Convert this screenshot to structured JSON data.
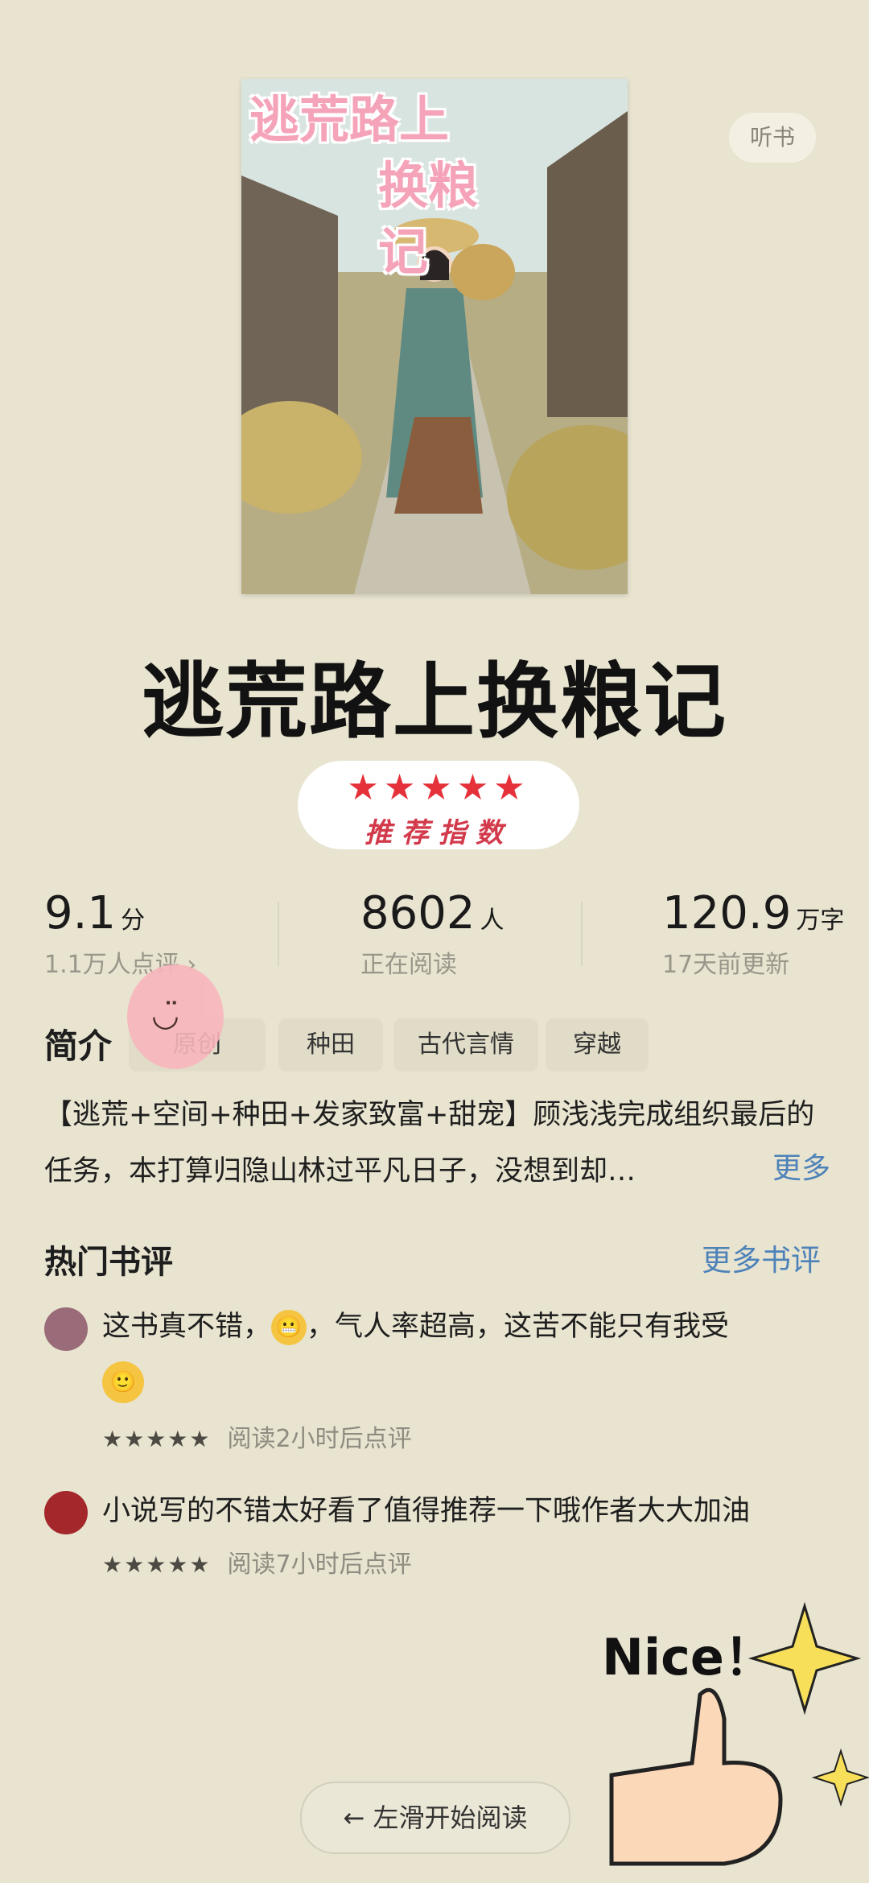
{
  "header": {
    "listen_label": "听书"
  },
  "cover": {
    "title_line1": "逃荒路上",
    "title_line2": "换粮记"
  },
  "book": {
    "title": "逃荒路上换粮记"
  },
  "recommend": {
    "stars": "★★★★★",
    "label": "推荐指数"
  },
  "stats": [
    {
      "value": "9.1",
      "unit": "分",
      "sub": "1.1万人点评 ›"
    },
    {
      "value": "8602",
      "unit": "人",
      "sub": "正在阅读"
    },
    {
      "value": "120.9",
      "unit": "万字",
      "sub": "17天前更新"
    }
  ],
  "intro": {
    "label": "简介",
    "tags": [
      "原创",
      "种田",
      "古代言情",
      "穿越"
    ],
    "text": "【逃荒+空间+种田+发家致富+甜宠】顾浅浅完成组织最后的任务，本打算归隐山林过平凡日子，没想到却…",
    "more": "更多"
  },
  "reviews_section": {
    "title": "热门书评",
    "more": "更多书评"
  },
  "reviews": [
    {
      "text_a": "这书真不错，",
      "text_b": "，气人率超高，这苦不能只有我受",
      "stars": "★★★★★",
      "meta": "阅读2小时后点评"
    },
    {
      "text": "小说写的不错太好看了值得推荐一下哦作者大大加油",
      "stars": "★★★★★",
      "meta": "阅读7小时后点评"
    }
  ],
  "sticker": {
    "text": "Nice！"
  },
  "footer": {
    "read_button": "← 左滑开始阅读"
  }
}
